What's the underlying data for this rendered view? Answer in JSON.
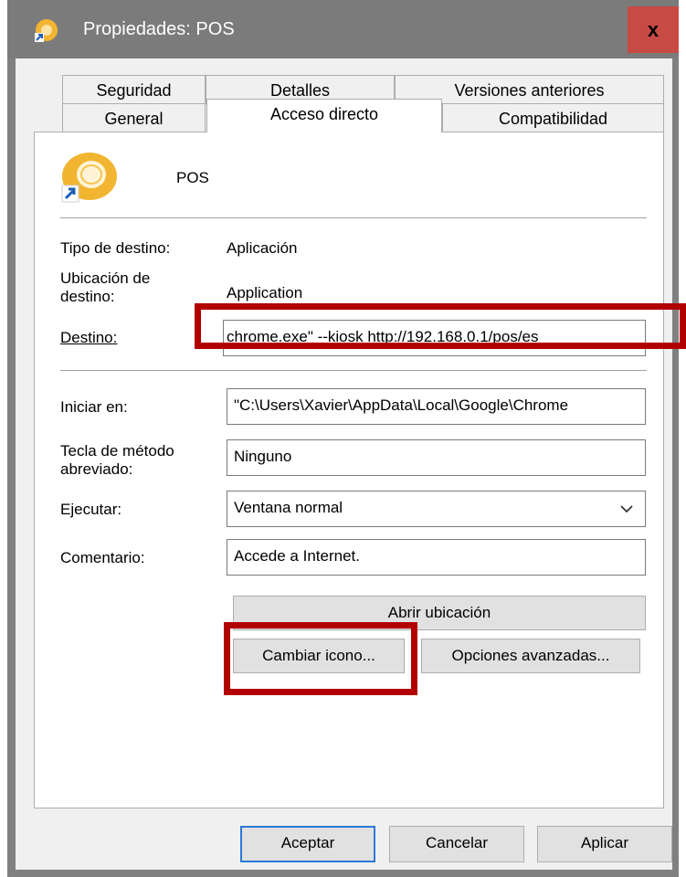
{
  "window": {
    "title": "Propiedades: POS",
    "close_glyph": "x"
  },
  "tabs": {
    "row1": [
      "Seguridad",
      "Detalles",
      "Versiones anteriores"
    ],
    "row2": [
      "General",
      "Acceso directo",
      "Compatibilidad"
    ],
    "active": "Acceso directo"
  },
  "shortcut": {
    "name": "POS",
    "icon": "chrome-app-shortcut-icon"
  },
  "info": {
    "target_type_label": "Tipo de destino:",
    "target_type_value": "Aplicación",
    "target_location_label_1": "Ubicación de",
    "target_location_label_2": "destino:",
    "target_location_value": "Application"
  },
  "fields": {
    "target_label": "Destino:",
    "target_value": "chrome.exe\" --kiosk http://192.168.0.1/pos/es",
    "start_in_label": "Iniciar en:",
    "start_in_value": "\"C:\\Users\\Xavier\\AppData\\Local\\Google\\Chrome",
    "shortcut_key_label_1": "Tecla de método",
    "shortcut_key_label_2": "abreviado:",
    "shortcut_key_value": "Ninguno",
    "run_label": "Ejecutar:",
    "run_value": "Ventana normal",
    "comment_label": "Comentario:",
    "comment_value": "Accede a Internet."
  },
  "buttons": {
    "open_location": "Abrir ubicación",
    "change_icon": "Cambiar icono...",
    "advanced": "Opciones avanzadas...",
    "ok": "Aceptar",
    "cancel": "Cancelar",
    "apply": "Aplicar"
  },
  "colors": {
    "highlight": "#b10000",
    "titlebar": "#7b7b7b",
    "close": "#c84a45",
    "focus": "#2b79d8"
  }
}
